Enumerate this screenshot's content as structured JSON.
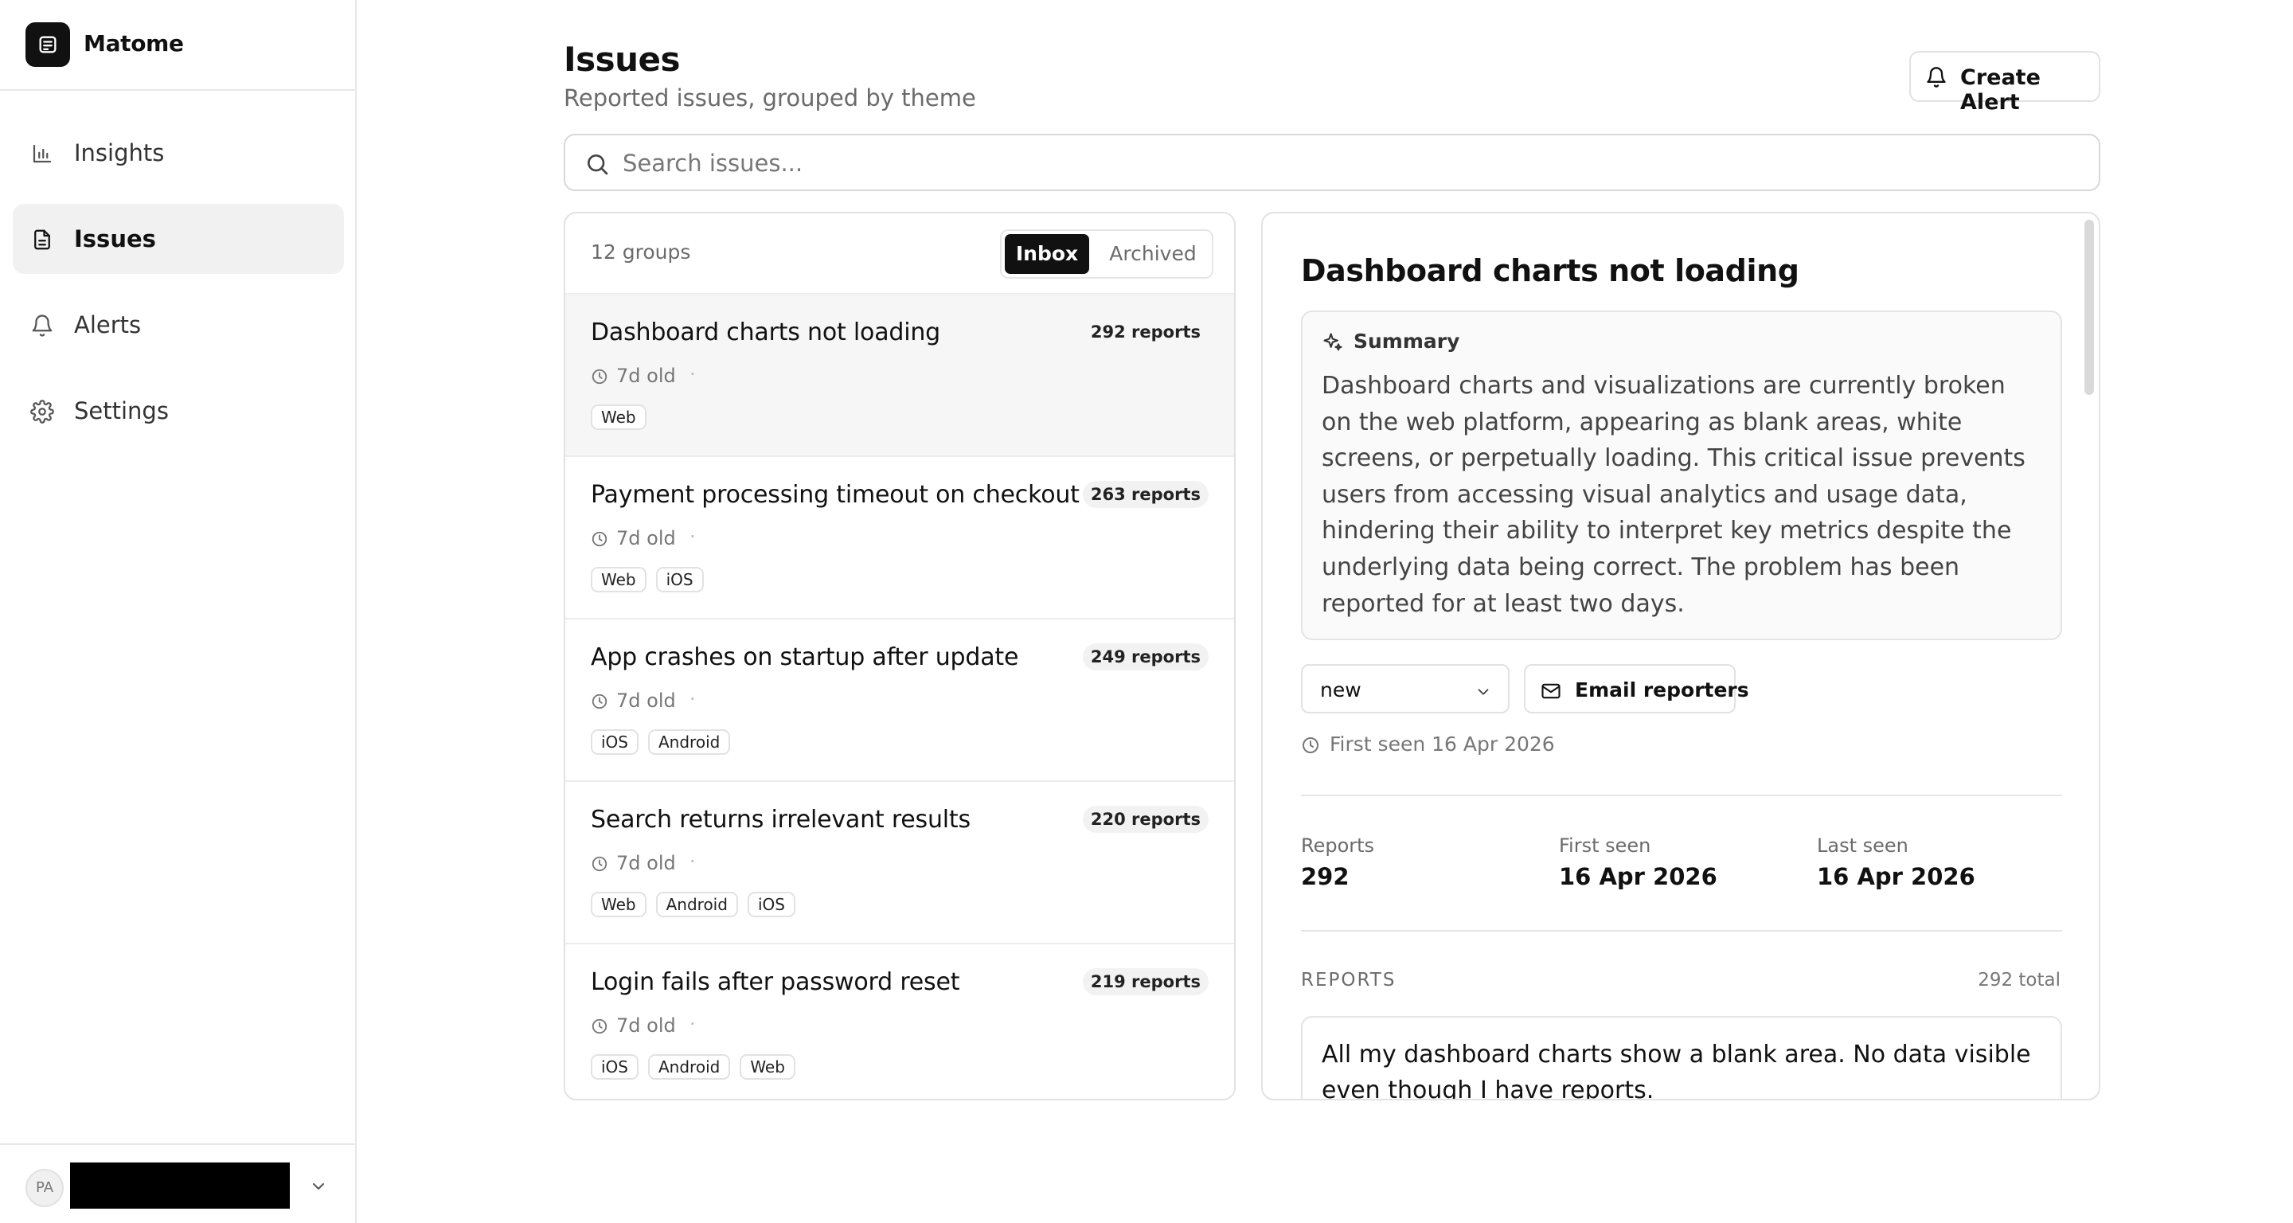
{
  "app": {
    "name": "Matome"
  },
  "sidebar": {
    "items": [
      {
        "label": "Insights",
        "icon": "bar-chart-icon",
        "active": false
      },
      {
        "label": "Issues",
        "icon": "document-icon",
        "active": true
      },
      {
        "label": "Alerts",
        "icon": "bell-icon",
        "active": false
      },
      {
        "label": "Settings",
        "icon": "gear-icon",
        "active": false
      }
    ],
    "user": {
      "initials": "PA"
    }
  },
  "header": {
    "title": "Issues",
    "subtitle": "Reported issues, grouped by theme",
    "create_alert_label": "Create Alert"
  },
  "search": {
    "placeholder": "Search issues...",
    "value": ""
  },
  "list": {
    "count_label": "12 groups",
    "tabs": {
      "inbox": "Inbox",
      "archived": "Archived",
      "selected": "Inbox"
    },
    "issues": [
      {
        "title": "Dashboard charts not loading",
        "reports": "292 reports",
        "age": "7d old",
        "tags": [
          "Web"
        ],
        "selected": true
      },
      {
        "title": "Payment processing timeout on checkout",
        "reports": "263 reports",
        "age": "7d old",
        "tags": [
          "Web",
          "iOS"
        ],
        "selected": false
      },
      {
        "title": "App crashes on startup after update",
        "reports": "249 reports",
        "age": "7d old",
        "tags": [
          "iOS",
          "Android"
        ],
        "selected": false
      },
      {
        "title": "Search returns irrelevant results",
        "reports": "220 reports",
        "age": "7d old",
        "tags": [
          "Web",
          "Android",
          "iOS"
        ],
        "selected": false
      },
      {
        "title": "Login fails after password reset",
        "reports": "219 reports",
        "age": "7d old",
        "tags": [
          "iOS",
          "Android",
          "Web"
        ],
        "selected": false
      }
    ]
  },
  "detail": {
    "title": "Dashboard charts not loading",
    "summary_label": "Summary",
    "summary_text": "Dashboard charts and visualizations are currently broken on the web platform, appearing as blank areas, white screens, or perpetually loading. This critical issue prevents users from accessing visual analytics and usage data, hindering their ability to interpret key metrics despite the underlying data being correct. The problem has been reported for at least two days.",
    "status": "new",
    "email_label": "Email reporters",
    "first_seen_text": "First seen 16 Apr 2026",
    "stats": {
      "reports_label": "Reports",
      "reports_value": "292",
      "first_seen_label": "First seen",
      "first_seen_value": "16 Apr 2026",
      "last_seen_label": "Last seen",
      "last_seen_value": "16 Apr 2026"
    },
    "reports_heading": "REPORTS",
    "reports_total": "292 total",
    "first_report_text": "All my dashboard charts show a blank area. No data visible even though I have reports."
  },
  "colors": {
    "accent": "#111111",
    "muted": "#6b6b6b",
    "selected_row": "#f6f6f6",
    "border": "#e2e2e2"
  }
}
